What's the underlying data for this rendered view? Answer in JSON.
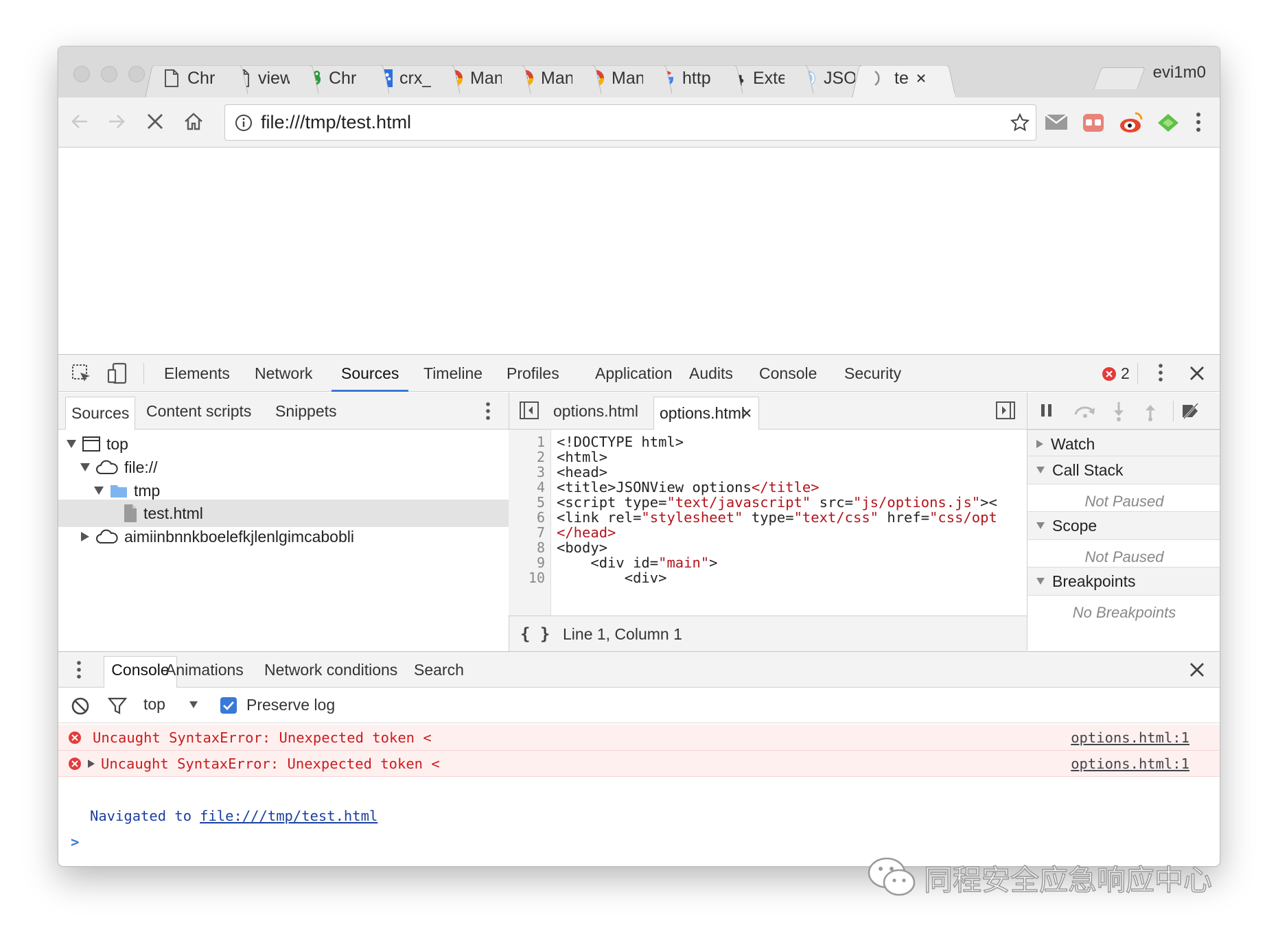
{
  "browser": {
    "tabs": [
      {
        "title": "Chr",
        "icon": "page-icon"
      },
      {
        "title": "view",
        "icon": "page-icon"
      },
      {
        "title": "Chr",
        "icon": "frog-icon"
      },
      {
        "title": "crx_",
        "icon": "paw-icon"
      },
      {
        "title": "Man",
        "icon": "chrome-icon"
      },
      {
        "title": "Man",
        "icon": "chrome-icon"
      },
      {
        "title": "Man",
        "icon": "chrome-icon"
      },
      {
        "title": "http",
        "icon": "google-icon"
      },
      {
        "title": "Exte",
        "icon": "puzzle-icon"
      },
      {
        "title": "JSO",
        "icon": "jsonview-icon"
      },
      {
        "title": "te",
        "icon": "loading-icon"
      }
    ],
    "profile_name": "evi1m0",
    "url": "file:///tmp/test.html"
  },
  "devtools": {
    "tabs": [
      "Elements",
      "Network",
      "Sources",
      "Timeline",
      "Profiles",
      "Application",
      "Audits",
      "Console",
      "Security"
    ],
    "selected_tab": "Sources",
    "error_count": "2",
    "navigator_tabs": [
      "Sources",
      "Content scripts",
      "Snippets"
    ],
    "tree": [
      {
        "label": "top",
        "icon": "frame-icon"
      },
      {
        "label": "file://",
        "icon": "cloud-icon"
      },
      {
        "label": "tmp",
        "icon": "folder-icon"
      },
      {
        "label": "test.html",
        "icon": "file-icon"
      },
      {
        "label": "aimiinbnnkboelefkjlenlgimcabobli",
        "icon": "cloud-icon"
      }
    ],
    "editor_tabs": [
      "options.html",
      "options.html"
    ],
    "code_lines": [
      {
        "n": "1",
        "parts": [
          [
            "t",
            "<!DOCTYPE html>"
          ]
        ]
      },
      {
        "n": "2",
        "parts": [
          [
            "t",
            "<html>"
          ]
        ]
      },
      {
        "n": "3",
        "parts": [
          [
            "t",
            "<head>"
          ]
        ]
      },
      {
        "n": "4",
        "parts": [
          [
            "t",
            "<title>JSONView options"
          ],
          [
            "s",
            "</title>"
          ]
        ]
      },
      {
        "n": "5",
        "parts": [
          [
            "t",
            "<script type="
          ],
          [
            "s",
            "\"text/javascript\""
          ],
          [
            "t",
            " src="
          ],
          [
            "s",
            "\"js/options.js\""
          ],
          [
            "t",
            "><"
          ]
        ]
      },
      {
        "n": "6",
        "parts": [
          [
            "t",
            "<link rel="
          ],
          [
            "s",
            "\"stylesheet\""
          ],
          [
            "t",
            " type="
          ],
          [
            "s",
            "\"text/css\""
          ],
          [
            "t",
            " href="
          ],
          [
            "s",
            "\"css/opt"
          ]
        ]
      },
      {
        "n": "7",
        "parts": [
          [
            "s",
            "</head>"
          ]
        ]
      },
      {
        "n": "8",
        "parts": [
          [
            "t",
            "<body>"
          ]
        ]
      },
      {
        "n": "9",
        "parts": [
          [
            "t",
            "    <div id="
          ],
          [
            "s",
            "\"main\""
          ],
          [
            "t",
            ">"
          ]
        ]
      },
      {
        "n": "10",
        "parts": [
          [
            "t",
            "        <div>"
          ]
        ]
      }
    ],
    "cursor_status": "Line 1, Column 1",
    "format_label": "{ }",
    "sidebar": {
      "watch": "Watch",
      "call_stack": "Call Stack",
      "call_stack_status": "Not Paused",
      "scope": "Scope",
      "scope_status": "Not Paused",
      "breakpoints": "Breakpoints",
      "breakpoints_status": "No Breakpoints"
    }
  },
  "drawer": {
    "tabs": [
      "Console",
      "Animations",
      "Network conditions",
      "Search"
    ],
    "context": "top",
    "preserve_log_label": "Preserve log",
    "preserve_log_checked": true,
    "messages": [
      {
        "type": "error",
        "text": "Uncaught SyntaxError: Unexpected token <",
        "source": "options.html:1",
        "expandable": false
      },
      {
        "type": "error",
        "text": "Uncaught SyntaxError: Unexpected token <",
        "source": "options.html:1",
        "expandable": true
      }
    ],
    "navigated_prefix": "Navigated to",
    "navigated_url": "file:///tmp/test.html",
    "prompt": ">"
  },
  "watermark": "同程安全应急响应中心"
}
